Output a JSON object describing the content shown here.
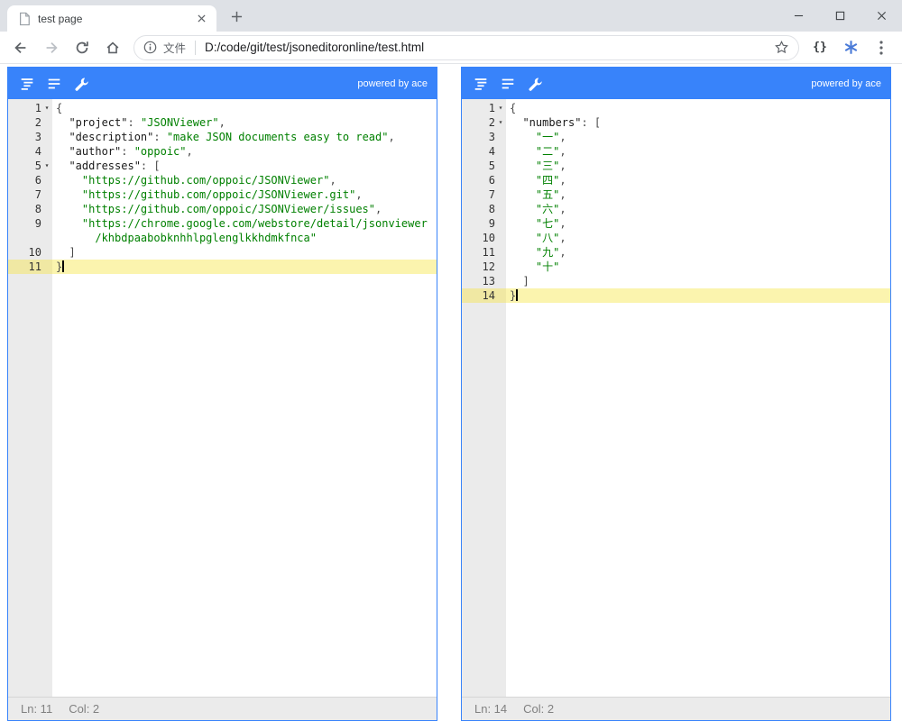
{
  "browser": {
    "tab_title": "test page",
    "address": {
      "scheme_label": "文件",
      "url": "D:/code/git/test/jsoneditoronline/test.html"
    },
    "extensions": {
      "braces_label": "{}"
    }
  },
  "fold_glyph": "▾",
  "editors": [
    {
      "powered_by": "powered by ace",
      "status": {
        "line": "Ln: 11",
        "col": "Col: 2"
      },
      "rows": [
        {
          "num": "1",
          "fold": true,
          "tokens": [
            {
              "c": "p",
              "t": "{"
            }
          ]
        },
        {
          "num": "2",
          "tokens": [
            {
              "c": "k",
              "t": "  \"project\""
            },
            {
              "c": "p",
              "t": ": "
            },
            {
              "c": "s",
              "t": "\"JSONViewer\""
            },
            {
              "c": "p",
              "t": ","
            }
          ]
        },
        {
          "num": "3",
          "tokens": [
            {
              "c": "k",
              "t": "  \"description\""
            },
            {
              "c": "p",
              "t": ": "
            },
            {
              "c": "s",
              "t": "\"make JSON documents easy to read\""
            },
            {
              "c": "p",
              "t": ","
            }
          ]
        },
        {
          "num": "4",
          "tokens": [
            {
              "c": "k",
              "t": "  \"author\""
            },
            {
              "c": "p",
              "t": ": "
            },
            {
              "c": "s",
              "t": "\"oppoic\""
            },
            {
              "c": "p",
              "t": ","
            }
          ]
        },
        {
          "num": "5",
          "fold": true,
          "tokens": [
            {
              "c": "k",
              "t": "  \"addresses\""
            },
            {
              "c": "p",
              "t": ": ["
            }
          ]
        },
        {
          "num": "6",
          "tokens": [
            {
              "c": "s",
              "t": "    \"https://github.com/oppoic/JSONViewer\""
            },
            {
              "c": "p",
              "t": ","
            }
          ]
        },
        {
          "num": "7",
          "tokens": [
            {
              "c": "s",
              "t": "    \"https://github.com/oppoic/JSONViewer.git\""
            },
            {
              "c": "p",
              "t": ","
            }
          ]
        },
        {
          "num": "8",
          "tokens": [
            {
              "c": "s",
              "t": "    \"https://github.com/oppoic/JSONViewer/issues\""
            },
            {
              "c": "p",
              "t": ","
            }
          ]
        },
        {
          "num": "9",
          "tokens": [
            {
              "c": "s",
              "t": "    \"https://chrome.google.com/webstore/detail/jsonviewer"
            }
          ]
        },
        {
          "num": "",
          "tokens": [
            {
              "c": "s",
              "t": "      /khbdpaabobknhhlpglenglkkhdmkfnca\""
            }
          ]
        },
        {
          "num": "10",
          "tokens": [
            {
              "c": "p",
              "t": "  ]"
            }
          ]
        },
        {
          "num": "11",
          "active": true,
          "cursor": true,
          "tokens": [
            {
              "c": "p",
              "t": "}"
            }
          ]
        }
      ]
    },
    {
      "powered_by": "powered by ace",
      "status": {
        "line": "Ln: 14",
        "col": "Col: 2"
      },
      "rows": [
        {
          "num": "1",
          "fold": true,
          "tokens": [
            {
              "c": "p",
              "t": "{"
            }
          ]
        },
        {
          "num": "2",
          "fold": true,
          "tokens": [
            {
              "c": "k",
              "t": "  \"numbers\""
            },
            {
              "c": "p",
              "t": ": ["
            }
          ]
        },
        {
          "num": "3",
          "tokens": [
            {
              "c": "s",
              "t": "    \"一\""
            },
            {
              "c": "p",
              "t": ","
            }
          ]
        },
        {
          "num": "4",
          "tokens": [
            {
              "c": "s",
              "t": "    \"二\""
            },
            {
              "c": "p",
              "t": ","
            }
          ]
        },
        {
          "num": "5",
          "tokens": [
            {
              "c": "s",
              "t": "    \"三\""
            },
            {
              "c": "p",
              "t": ","
            }
          ]
        },
        {
          "num": "6",
          "tokens": [
            {
              "c": "s",
              "t": "    \"四\""
            },
            {
              "c": "p",
              "t": ","
            }
          ]
        },
        {
          "num": "7",
          "tokens": [
            {
              "c": "s",
              "t": "    \"五\""
            },
            {
              "c": "p",
              "t": ","
            }
          ]
        },
        {
          "num": "8",
          "tokens": [
            {
              "c": "s",
              "t": "    \"六\""
            },
            {
              "c": "p",
              "t": ","
            }
          ]
        },
        {
          "num": "9",
          "tokens": [
            {
              "c": "s",
              "t": "    \"七\""
            },
            {
              "c": "p",
              "t": ","
            }
          ]
        },
        {
          "num": "10",
          "tokens": [
            {
              "c": "s",
              "t": "    \"八\""
            },
            {
              "c": "p",
              "t": ","
            }
          ]
        },
        {
          "num": "11",
          "tokens": [
            {
              "c": "s",
              "t": "    \"九\""
            },
            {
              "c": "p",
              "t": ","
            }
          ]
        },
        {
          "num": "12",
          "tokens": [
            {
              "c": "s",
              "t": "    \"十\""
            }
          ]
        },
        {
          "num": "13",
          "tokens": [
            {
              "c": "p",
              "t": "  ]"
            }
          ]
        },
        {
          "num": "14",
          "active": true,
          "cursor": true,
          "tokens": [
            {
              "c": "p",
              "t": "}"
            }
          ]
        }
      ]
    }
  ]
}
